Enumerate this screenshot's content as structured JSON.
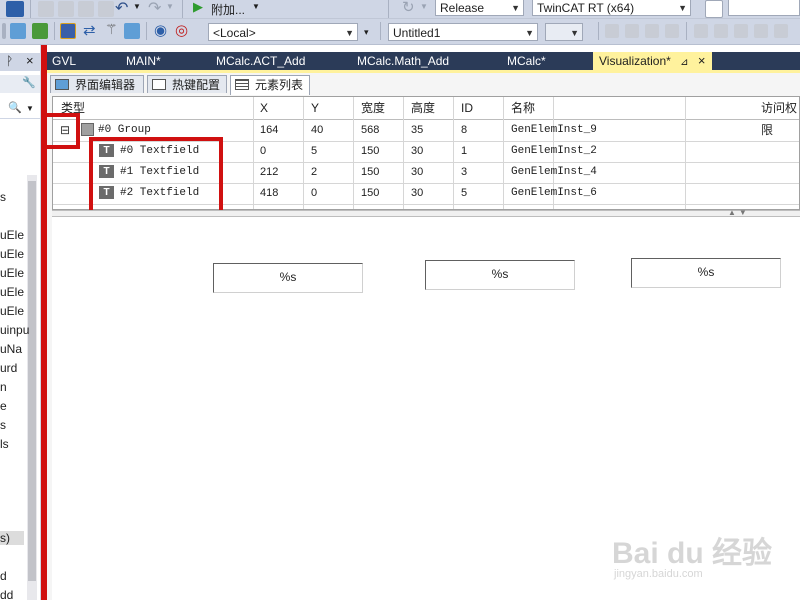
{
  "toolbar": {
    "attach_label": "附加...",
    "config_value": "Release",
    "platform_value": "TwinCAT RT (x64)",
    "target_value": "<Local>",
    "project_value": "Untitled1"
  },
  "left_panel": {
    "pin_glyph": "ᚹ",
    "wrench_glyph": "🔧",
    "search_glyph": "🔍",
    "close_glyph": "×",
    "items": [
      "s",
      "uEle",
      "uEle",
      "uEle",
      "uEle",
      "uEle",
      "uinpu",
      "uNa",
      "urd",
      "n",
      "e",
      "s",
      "ls",
      "s)",
      "d",
      "dd"
    ]
  },
  "doc_tabs": [
    {
      "label": "GVL"
    },
    {
      "label": "MAIN*"
    },
    {
      "label": "MCalc.ACT_Add"
    },
    {
      "label": "MCalc.Math_Add"
    },
    {
      "label": "MCalc*"
    },
    {
      "label": "Visualization*",
      "active": true,
      "pin": "⊿",
      "close": "×"
    }
  ],
  "sub_tabs": [
    {
      "label": "界面编辑器"
    },
    {
      "label": "热键配置"
    },
    {
      "label": "元素列表",
      "active": true
    }
  ],
  "element_list": {
    "columns": [
      "类型",
      "X",
      "Y",
      "宽度",
      "高度",
      "ID",
      "名称",
      "访问权限"
    ],
    "rows": [
      {
        "type": "#0 Group",
        "x": "164",
        "y": "40",
        "w": "568",
        "h": "35",
        "id": "8",
        "name": "GenElemInst_9",
        "expander": "⊟"
      },
      {
        "type": "#0 Textfield",
        "x": "0",
        "y": "5",
        "w": "150",
        "h": "30",
        "id": "1",
        "name": "GenElemInst_2"
      },
      {
        "type": "#1 Textfield",
        "x": "212",
        "y": "2",
        "w": "150",
        "h": "30",
        "id": "3",
        "name": "GenElemInst_4"
      },
      {
        "type": "#2 Textfield",
        "x": "418",
        "y": "0",
        "w": "150",
        "h": "30",
        "id": "5",
        "name": "GenElemInst_6"
      }
    ],
    "type_icon_glyph": "T"
  },
  "splitter": {
    "arrows": "▲▼"
  },
  "canvas": {
    "textfields": [
      {
        "text": "%s"
      },
      {
        "text": "%s"
      },
      {
        "text": "%s"
      }
    ]
  },
  "watermark": {
    "main": "Bai du 经验",
    "sub": "jingyan.baidu.com"
  },
  "colors": {
    "toolbar_bg": "#cfd6e5",
    "tab_strip_bg": "#2b3b58",
    "active_tab_bg": "#fff29d",
    "highlight_red": "#d01010"
  }
}
